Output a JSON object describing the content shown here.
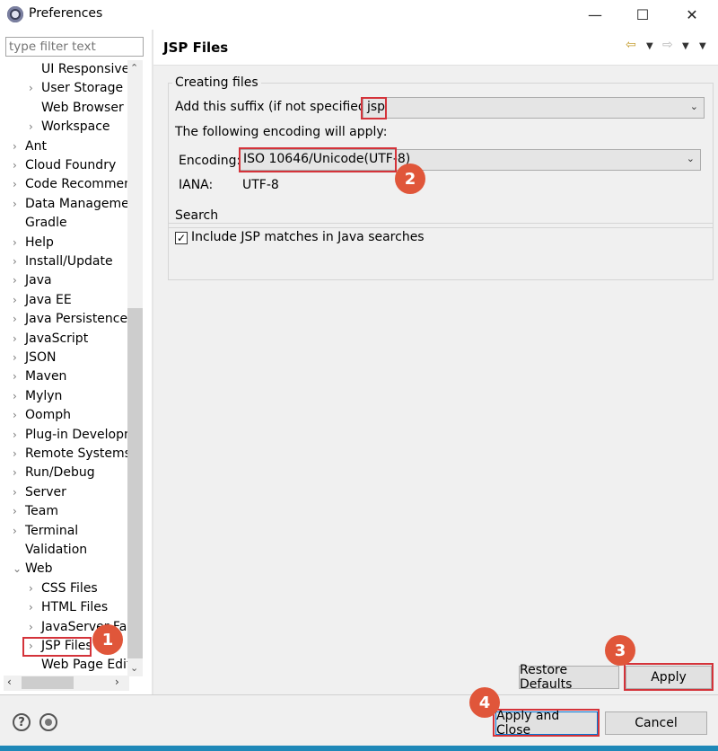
{
  "window": {
    "title": "Preferences",
    "minimize": "—",
    "maximize": "☐",
    "close": "✕"
  },
  "filter": {
    "placeholder": "type filter text"
  },
  "tree": [
    {
      "label": "UI Responsiven",
      "level": 2,
      "expander": ""
    },
    {
      "label": "User Storage Se",
      "level": 2,
      "expander": "›"
    },
    {
      "label": "Web Browser",
      "level": 2,
      "expander": ""
    },
    {
      "label": "Workspace",
      "level": 2,
      "expander": "›"
    },
    {
      "label": "Ant",
      "level": 1,
      "expander": "›"
    },
    {
      "label": "Cloud Foundry",
      "level": 1,
      "expander": "›"
    },
    {
      "label": "Code Recommend",
      "level": 1,
      "expander": "›"
    },
    {
      "label": "Data Managemen",
      "level": 1,
      "expander": "›"
    },
    {
      "label": "Gradle",
      "level": 1,
      "expander": ""
    },
    {
      "label": "Help",
      "level": 1,
      "expander": "›"
    },
    {
      "label": "Install/Update",
      "level": 1,
      "expander": "›"
    },
    {
      "label": "Java",
      "level": 1,
      "expander": "›"
    },
    {
      "label": "Java EE",
      "level": 1,
      "expander": "›"
    },
    {
      "label": "Java Persistence",
      "level": 1,
      "expander": "›"
    },
    {
      "label": "JavaScript",
      "level": 1,
      "expander": "›"
    },
    {
      "label": "JSON",
      "level": 1,
      "expander": "›"
    },
    {
      "label": "Maven",
      "level": 1,
      "expander": "›"
    },
    {
      "label": "Mylyn",
      "level": 1,
      "expander": "›"
    },
    {
      "label": "Oomph",
      "level": 1,
      "expander": "›"
    },
    {
      "label": "Plug-in Developm",
      "level": 1,
      "expander": "›"
    },
    {
      "label": "Remote Systems",
      "level": 1,
      "expander": "›"
    },
    {
      "label": "Run/Debug",
      "level": 1,
      "expander": "›"
    },
    {
      "label": "Server",
      "level": 1,
      "expander": "›"
    },
    {
      "label": "Team",
      "level": 1,
      "expander": "›"
    },
    {
      "label": "Terminal",
      "level": 1,
      "expander": "›"
    },
    {
      "label": "Validation",
      "level": 1,
      "expander": ""
    },
    {
      "label": "Web",
      "level": 1,
      "expander": "⌄"
    },
    {
      "label": "CSS Files",
      "level": 2,
      "expander": "›"
    },
    {
      "label": "HTML Files",
      "level": 2,
      "expander": "›"
    },
    {
      "label": "JavaServer Face",
      "level": 2,
      "expander": "›"
    },
    {
      "label": "JSP Files",
      "level": 2,
      "expander": "›"
    },
    {
      "label": "Web Page Edit",
      "level": 2,
      "expander": ""
    }
  ],
  "page": {
    "title": "JSP Files",
    "nav_back": "⇦",
    "nav_forward": "⇨",
    "dropdown": "▼"
  },
  "creating": {
    "legend": "Creating files",
    "suffix_label": "Add this suffix (if not specified):",
    "suffix_value": "jsp",
    "encoding_intro": "The following encoding will apply:",
    "encoding_label": "Encoding:",
    "encoding_value": "ISO 10646/Unicode(UTF-8)",
    "iana_label": "IANA:",
    "iana_value": "UTF-8"
  },
  "search": {
    "legend": "Search",
    "include_label": "Include JSP matches in Java searches",
    "include_checked": true
  },
  "buttons": {
    "restore_defaults": "Restore Defaults",
    "apply": "Apply",
    "apply_and_close": "Apply and Close",
    "cancel": "Cancel"
  },
  "bottom_icons": {
    "help": "?"
  },
  "badges": {
    "b1": "1",
    "b2": "2",
    "b3": "3",
    "b4": "4"
  },
  "colors": {
    "highlight": "#d4333a",
    "badge": "#e0563a",
    "primary_border": "#0078d7"
  }
}
